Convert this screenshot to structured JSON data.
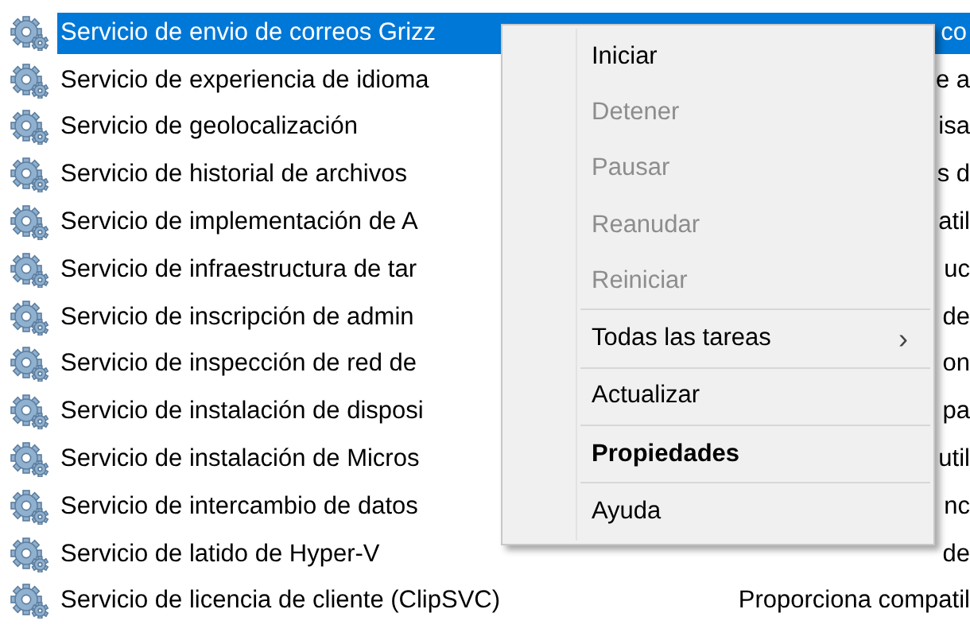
{
  "services": [
    {
      "name": "Servicio de envio de correos Grizz",
      "description": "co",
      "selected": true
    },
    {
      "name": "Servicio de experiencia de idioma",
      "description": "e a",
      "selected": false
    },
    {
      "name": "Servicio de geolocalización",
      "description": "isa",
      "selected": false
    },
    {
      "name": "Servicio de historial de archivos",
      "description": "s d",
      "selected": false
    },
    {
      "name": "Servicio de implementación de A",
      "description": "atil",
      "selected": false
    },
    {
      "name": "Servicio de infraestructura de tar",
      "description": "uc",
      "selected": false
    },
    {
      "name": "Servicio de inscripción de admin",
      "description": "de",
      "selected": false
    },
    {
      "name": "Servicio de inspección de red de",
      "description": "on",
      "selected": false
    },
    {
      "name": "Servicio de instalación de disposi",
      "description": "pa",
      "selected": false
    },
    {
      "name": "Servicio de instalación de Micros",
      "description": "util",
      "selected": false
    },
    {
      "name": "Servicio de intercambio de datos",
      "description": "nc",
      "selected": false
    },
    {
      "name": "Servicio de latido de Hyper-V",
      "description": "de",
      "selected": false
    },
    {
      "name": "Servicio de licencia de cliente (ClipSVC)",
      "description": "Proporciona compatil",
      "selected": false
    }
  ],
  "context_menu": [
    {
      "kind": "item",
      "label": "Iniciar",
      "disabled": false,
      "default": false
    },
    {
      "kind": "item",
      "label": "Detener",
      "disabled": true,
      "default": false
    },
    {
      "kind": "item",
      "label": "Pausar",
      "disabled": true,
      "default": false
    },
    {
      "kind": "item",
      "label": "Reanudar",
      "disabled": true,
      "default": false
    },
    {
      "kind": "item",
      "label": "Reiniciar",
      "disabled": true,
      "default": false
    },
    {
      "kind": "separator"
    },
    {
      "kind": "submenu",
      "label": "Todas las tareas",
      "arrow": "›",
      "disabled": false,
      "default": false
    },
    {
      "kind": "separator"
    },
    {
      "kind": "item",
      "label": "Actualizar",
      "disabled": false,
      "default": false
    },
    {
      "kind": "separator"
    },
    {
      "kind": "item",
      "label": "Propiedades",
      "disabled": false,
      "default": true
    },
    {
      "kind": "separator"
    },
    {
      "kind": "item",
      "label": "Ayuda",
      "disabled": false,
      "default": false
    }
  ]
}
